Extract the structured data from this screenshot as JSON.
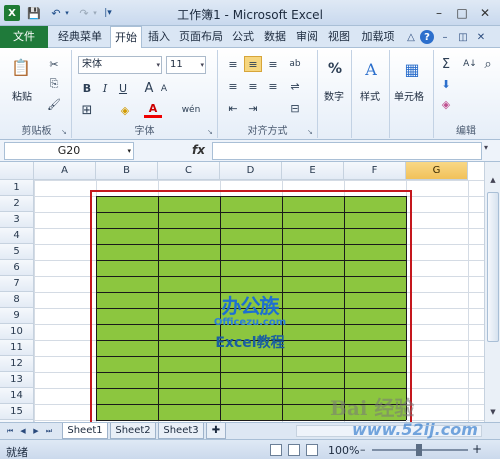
{
  "window": {
    "title": "工作簿1 - Microsoft Excel",
    "app_icon": "X",
    "save_icon": "💾",
    "undo_icon": "↶",
    "redo_icon": "↷",
    "dropdown": "▾",
    "customize": "|▾",
    "min": "–",
    "max": "□",
    "close": "✕"
  },
  "tabs": [
    {
      "label": "文件"
    },
    {
      "label": "经典菜单"
    },
    {
      "label": "开始"
    },
    {
      "label": "插入"
    },
    {
      "label": "页面布局"
    },
    {
      "label": "公式"
    },
    {
      "label": "数据"
    },
    {
      "label": "审阅"
    },
    {
      "label": "视图"
    },
    {
      "label": "加载项"
    }
  ],
  "menubar_icons": {
    "ribbon_min": "△",
    "help": "?",
    "min": "–",
    "restore": "◫",
    "close": "✕"
  },
  "ribbon": {
    "clipboard": {
      "label": "剪贴板",
      "paste": "粘贴",
      "paste_icon": "📋",
      "cut_icon": "✂",
      "copy_icon": "⎘",
      "painter_icon": "🖌"
    },
    "font": {
      "label": "字体",
      "font_name": "宋体",
      "font_size": "11",
      "grow_icon": "A",
      "shrink_icon": "A",
      "bold": "B",
      "italic": "I",
      "underline": "U",
      "border_icon": "⊞",
      "fill_icon": "◈",
      "color_icon": "A",
      "wen_icon": "wén"
    },
    "align": {
      "label": "对齐方式",
      "top": "≡",
      "middle": "≡",
      "bottom": "≡",
      "wrap": "⇌",
      "left": "≡",
      "center": "≡",
      "right": "≡",
      "merge": "⊟",
      "indent_dec": "⇤",
      "indent_inc": "⇥",
      "orient": "ab"
    },
    "number": {
      "label": "数字",
      "icon": "%"
    },
    "styles": {
      "label": "样式",
      "icon": "A"
    },
    "cells": {
      "label": "单元格",
      "icon": "▦"
    },
    "edit": {
      "label": "编辑",
      "sum": "Σ",
      "fill": "⬇",
      "clear": "◈",
      "sort": "A↓",
      "find": "⌕"
    },
    "launcher": "↘"
  },
  "formula_bar": {
    "name_box": "G20",
    "fx": "fx",
    "formula": "",
    "expand": "▾"
  },
  "sheet": {
    "columns": [
      "A",
      "B",
      "C",
      "D",
      "E",
      "F",
      "G"
    ],
    "rows": [
      "1",
      "2",
      "3",
      "4",
      "5",
      "6",
      "7",
      "8",
      "9",
      "10",
      "11",
      "12",
      "13",
      "14",
      "15"
    ],
    "fill_color": "#8cc63f",
    "border_color": "#c4171d",
    "selected_column": "G"
  },
  "sheet_tabs": {
    "nav": [
      "⏮",
      "◀",
      "▶",
      "⏭"
    ],
    "tabs": [
      "Sheet1",
      "Sheet2",
      "Sheet3"
    ],
    "new_icon": "✚"
  },
  "status": {
    "text": "就绪",
    "zoom": "100%",
    "zoom_out": "–",
    "zoom_in": "+"
  },
  "watermarks": {
    "logo": "办公族",
    "logo_sub": "Officezu.com",
    "caption": "Excel教程",
    "baidu": "Bai 经验",
    "site": "www.52ij.com"
  }
}
